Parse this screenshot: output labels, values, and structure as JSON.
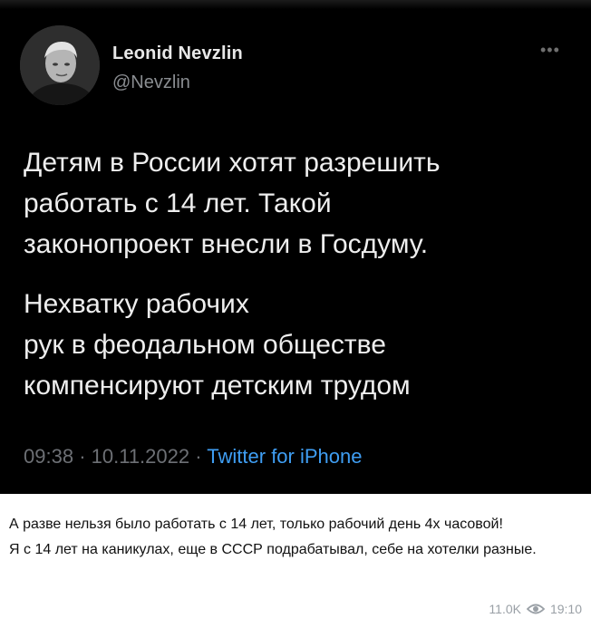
{
  "tweet": {
    "author_name": "Leonid Nevzlin",
    "author_handle": "@Nevzlin",
    "paragraph1": "Детям в России хотят разрешить\nработать с 14 лет. Такой\nзаконопроект  внесли в Госдуму.",
    "paragraph2": "Нехватку рабочих\n рук в феодальном обществе\nкомпенсируют детским трудом",
    "time": "09:38",
    "date": "10.11.2022",
    "source": "Twitter for iPhone",
    "more_icon": "more-dots-icon"
  },
  "post": {
    "caption_line1": "А разве нельзя было работать с 14 лет, только рабочий день 4х часовой!",
    "caption_line2": "Я с 14 лет на каникулах, еще в СССР подрабатывал, себе на хотелки разные.",
    "views": "11.0K",
    "views_icon": "eye-icon",
    "time": "19:10"
  },
  "colors": {
    "tweet_background": "#000000",
    "link_blue": "#3f9ef3",
    "meta_gray": "#6d7075"
  }
}
